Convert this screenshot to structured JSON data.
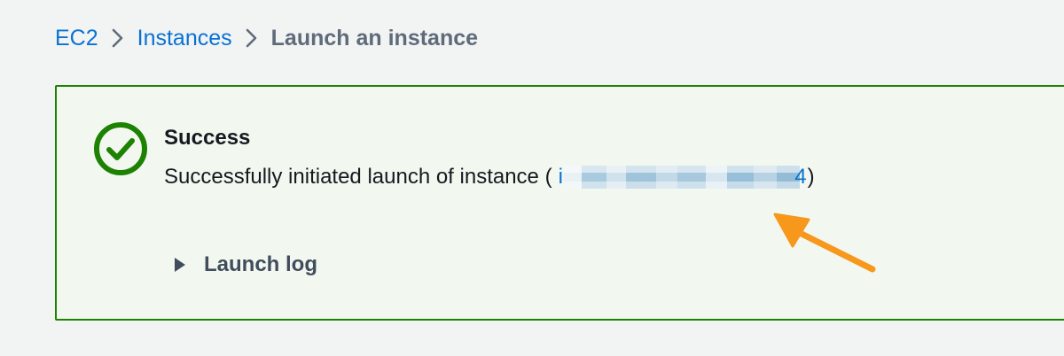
{
  "breadcrumb": {
    "items": [
      {
        "label": "EC2"
      },
      {
        "label": "Instances"
      }
    ],
    "current": "Launch an instance"
  },
  "flash": {
    "type": "success",
    "title": "Success",
    "message_prefix": "Successfully initiated launch of instance (",
    "instance_id_start": "i",
    "instance_id_end": "4",
    "message_suffix": ")",
    "launch_log_label": "Launch log"
  },
  "colors": {
    "link": "#0972d3",
    "success": "#1d8102",
    "annotation_arrow": "#f7981d"
  },
  "icons": {
    "status": "check-circle-icon",
    "breadcrumb_separator": "chevron-right-icon",
    "expand": "caret-right-icon",
    "annotation": "arrow-icon"
  }
}
